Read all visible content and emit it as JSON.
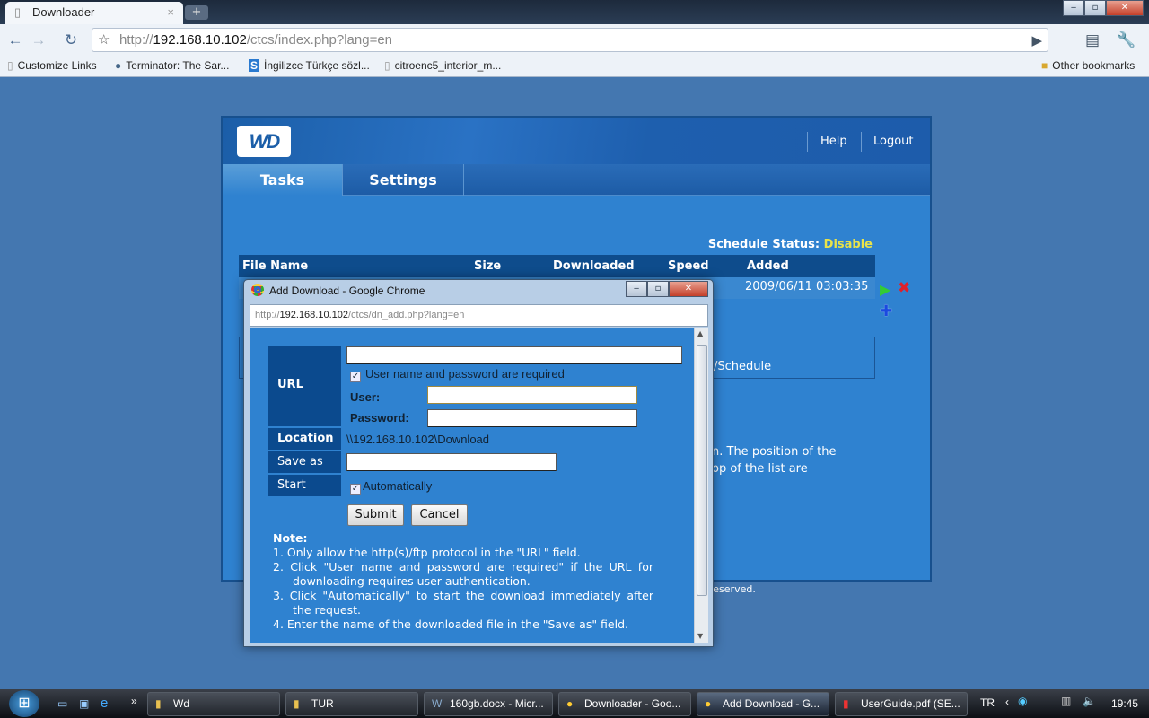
{
  "browser": {
    "tab_title": "Downloader",
    "new_tab": "+",
    "url_host": "192.168.10.102",
    "url_prefix": "http://",
    "url_path": "/ctcs/index.php?lang=en",
    "bookmarks": [
      "Customize Links",
      "Terminator: The Sar...",
      "İngilizce Türkçe sözl...",
      "citroenc5_interior_m..."
    ],
    "other_bookmarks": "Other bookmarks"
  },
  "wd": {
    "logo": "WD",
    "help": "Help",
    "logout": "Logout",
    "tabs": [
      "Tasks",
      "Settings"
    ],
    "schedule_label": "Schedule Status:",
    "schedule_value": "Disable",
    "columns": [
      "File Name",
      "Size",
      "Downloaded",
      "Speed",
      "Added"
    ],
    "row": {
      "added": "2009/06/11 03:03:35"
    },
    "partial_text": [
      "e/Schedule",
      "n. The position of the",
      "op of the list are"
    ],
    "footer": "reserved."
  },
  "dialog": {
    "title": "Add Download - Google Chrome",
    "url_prefix": "http://",
    "url_host": "192.168.10.102",
    "url_path": "/ctcs/dn_add.php?lang=en",
    "labels": {
      "url": "URL",
      "location": "Location",
      "save_as": "Save as",
      "start": "Start",
      "user": "User:",
      "password": "Password:"
    },
    "auth_checkbox": "User name and password are required",
    "auth_checked": true,
    "location_value": "\\\\192.168.10.102\\Download",
    "start_checkbox": "Automatically",
    "start_checked": true,
    "url_value": "",
    "user_value": "",
    "password_value": "",
    "save_as_value": "",
    "submit": "Submit",
    "cancel": "Cancel",
    "note_title": "Note:",
    "notes": [
      "1.  Only allow the http(s)/ftp protocol in the \"URL\" field.",
      "2.  Click \"User name and password are required\" if the URL for downloading requires user authentication.",
      "3.  Click \"Automatically\" to start the download immediately after the request.",
      "4.  Enter the name of the downloaded file in the \"Save as\" field."
    ]
  },
  "taskbar": {
    "tasks": [
      "Wd",
      "TUR",
      "160gb.docx - Micr...",
      "Downloader - Goo...",
      "Add Download - G...",
      "UserGuide.pdf (SE..."
    ],
    "lang": "TR",
    "clock": "19:45"
  }
}
